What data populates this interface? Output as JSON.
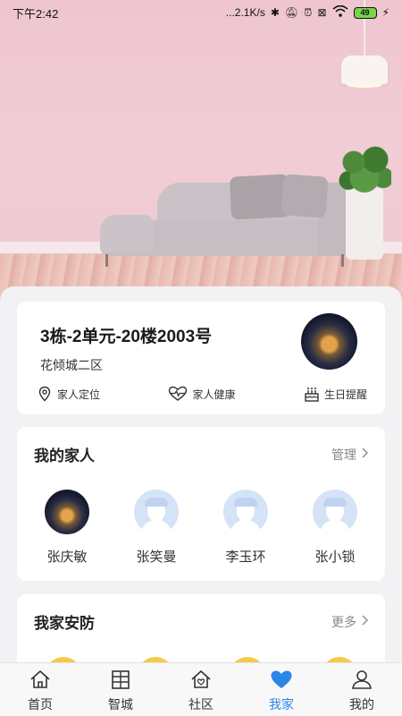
{
  "status_bar": {
    "time": "下午2:42",
    "network_speed": "...2.1K/s",
    "battery": "49"
  },
  "home": {
    "address": "3栋-2单元-20楼2003号",
    "community": "花倾城二区",
    "actions": [
      {
        "label": "家人定位",
        "icon": "location-pin-icon"
      },
      {
        "label": "家人健康",
        "icon": "heart-pulse-icon"
      },
      {
        "label": "生日提醒",
        "icon": "birthday-cake-icon"
      }
    ]
  },
  "family": {
    "title": "我的家人",
    "manage_label": "管理",
    "members": [
      {
        "name": "张庆敏",
        "avatar": "photo"
      },
      {
        "name": "张笑曼",
        "avatar": "default"
      },
      {
        "name": "李玉环",
        "avatar": "default"
      },
      {
        "name": "张小锁",
        "avatar": "default"
      }
    ]
  },
  "security": {
    "title": "我家安防",
    "more_label": "更多"
  },
  "nav": {
    "items": [
      {
        "label": "首页",
        "icon": "home-icon"
      },
      {
        "label": "智城",
        "icon": "city-building-icon"
      },
      {
        "label": "社区",
        "icon": "community-house-icon"
      },
      {
        "label": "我家",
        "icon": "heart-icon",
        "active": true
      },
      {
        "label": "我的",
        "icon": "person-icon"
      }
    ],
    "active_color": "#2a86e8"
  }
}
